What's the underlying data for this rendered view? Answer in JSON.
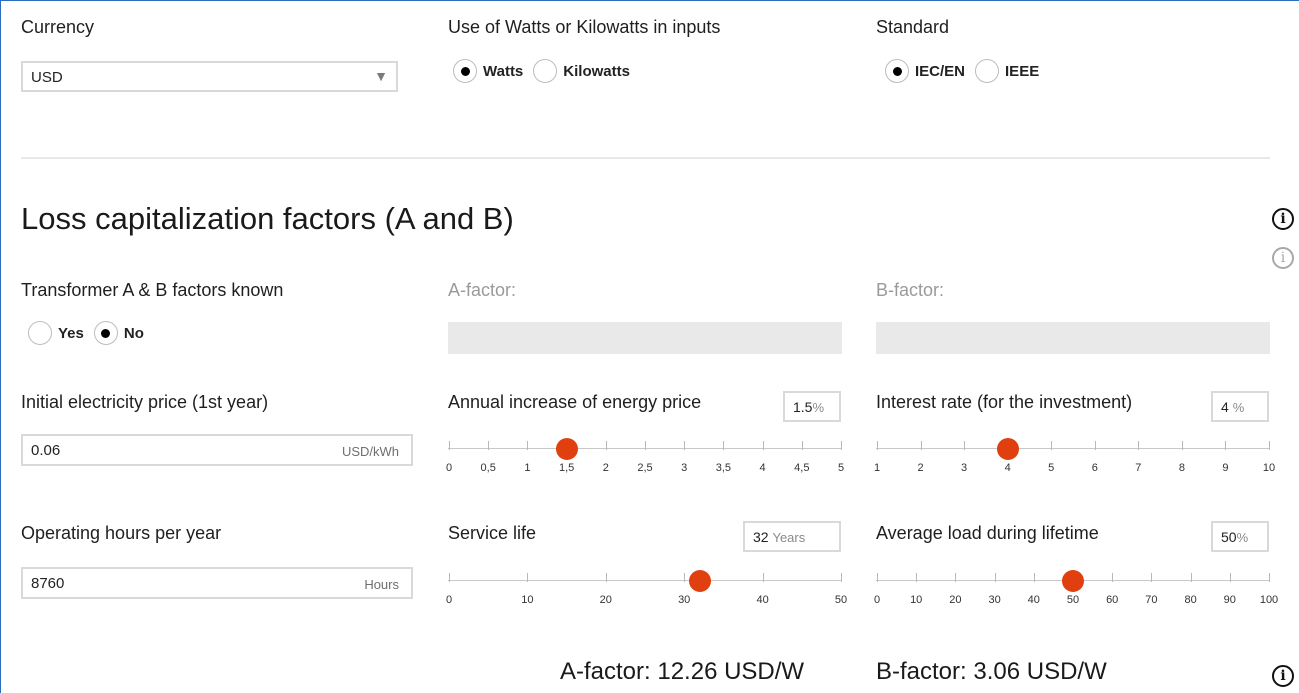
{
  "settings": {
    "currency_label": "Currency",
    "currency_value": "USD",
    "units_label": "Use of Watts or Kilowatts in inputs",
    "units_options": [
      "Watts",
      "Kilowatts"
    ],
    "units_selected": "Watts",
    "standard_label": "Standard",
    "standard_options": [
      "IEC/EN",
      "IEEE"
    ],
    "standard_selected": "IEC/EN"
  },
  "section": {
    "title": "Loss capitalization factors (A and B)"
  },
  "factors_known": {
    "label": "Transformer A & B factors known",
    "options": [
      "Yes",
      "No"
    ],
    "selected": "No",
    "a_factor_label": "A-factor:",
    "b_factor_label": "B-factor:"
  },
  "electricity_price": {
    "label": "Initial electricity price (1st year)",
    "value": "0.06",
    "unit": "USD/kWh"
  },
  "operating_hours": {
    "label": "Operating hours per year",
    "value": "8760",
    "unit": "Hours"
  },
  "energy_price_increase": {
    "label": "Annual increase of energy price",
    "value_text": "1.5",
    "unit": "%",
    "value": 1.5,
    "min": 0,
    "max": 5,
    "ticks": [
      "0",
      "0,5",
      "1",
      "1,5",
      "2",
      "2,5",
      "3",
      "3,5",
      "4",
      "4,5",
      "5"
    ]
  },
  "interest_rate": {
    "label": "Interest rate (for the investment)",
    "value_text": "4",
    "unit": "%",
    "value": 4,
    "min": 1,
    "max": 10,
    "ticks": [
      "1",
      "2",
      "3",
      "4",
      "5",
      "6",
      "7",
      "8",
      "9",
      "10"
    ]
  },
  "service_life": {
    "label": "Service life",
    "value_text": "32",
    "unit": "Years",
    "value": 32,
    "min": 0,
    "max": 50,
    "ticks": [
      "0",
      "10",
      "20",
      "30",
      "40",
      "50"
    ]
  },
  "average_load": {
    "label": "Average load during lifetime",
    "value_text": "50",
    "unit": "%",
    "value": 50,
    "min": 0,
    "max": 100,
    "ticks": [
      "0",
      "10",
      "20",
      "30",
      "40",
      "50",
      "60",
      "70",
      "80",
      "90",
      "100"
    ]
  },
  "results": {
    "a_factor": "A-factor: 12.26 USD/W",
    "b_factor": "B-factor: 3.06 USD/W"
  },
  "colors": {
    "accent": "#e0400f",
    "window_border": "#2a6fbd"
  }
}
